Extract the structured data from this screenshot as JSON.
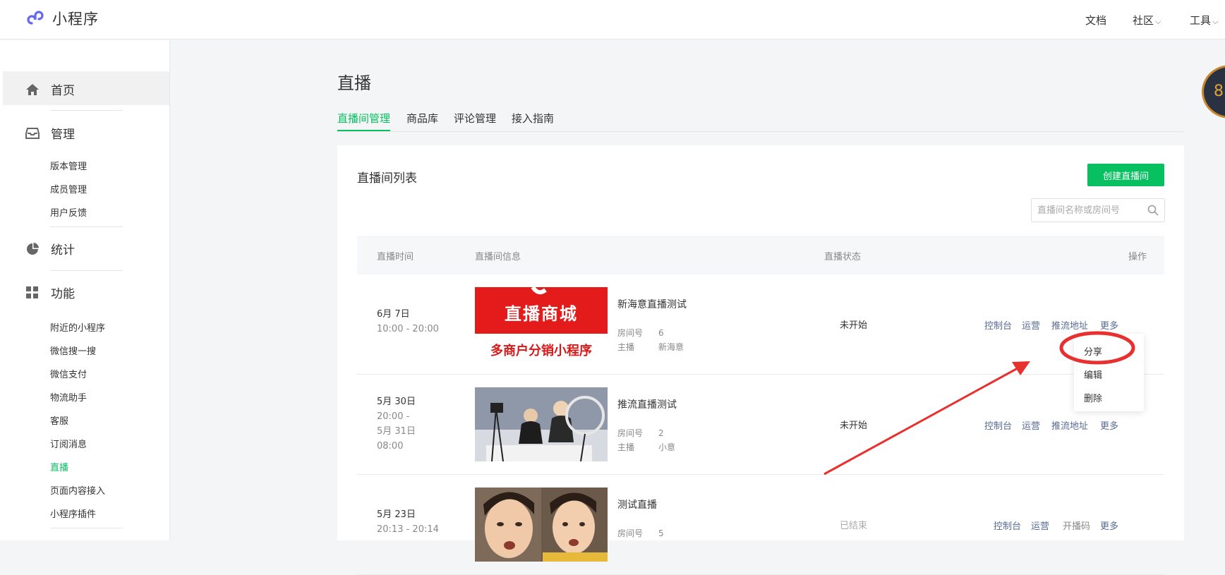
{
  "app": {
    "name": "小程序"
  },
  "topnav": {
    "docs": "文档",
    "community": "社区",
    "tools": "工具",
    "chevron": "⌵"
  },
  "sidebar": {
    "home": "首页",
    "manage": {
      "label": "管理",
      "items": [
        "版本管理",
        "成员管理",
        "用户反馈"
      ]
    },
    "stats": {
      "label": "统计"
    },
    "features": {
      "label": "功能",
      "items": [
        "附近的小程序",
        "微信搜一搜",
        "微信支付",
        "物流助手",
        "客服",
        "订阅消息",
        "直播",
        "页面内容接入",
        "小程序插件"
      ]
    }
  },
  "page": {
    "title": "直播",
    "tabs": [
      "直播间管理",
      "商品库",
      "评论管理",
      "接入指南"
    ],
    "list_title": "直播间列表",
    "create_button": "创建直播间",
    "search_placeholder": "直播间名称或房间号"
  },
  "table": {
    "headers": {
      "time": "直播时间",
      "info": "直播间信息",
      "status": "直播状态",
      "ops": "操作"
    },
    "labels": {
      "room": "房间号",
      "host": "主播"
    },
    "rows": [
      {
        "date": "6月 7日",
        "time": "10:00 - 20:00",
        "name": "新海意直播测试",
        "room": "6",
        "host": "新海意",
        "status": "未开始",
        "ops": [
          "控制台",
          "运营",
          "推流地址",
          "更多"
        ],
        "thumb_line1": "直播商城",
        "thumb_line2": "多商户分销小程序"
      },
      {
        "date": "5月 30日",
        "time": "20:00 -",
        "date2": "5月 31日",
        "time2": "08:00",
        "name": "推流直播测试",
        "room": "2",
        "host": "小意",
        "status": "未开始",
        "ops": [
          "控制台",
          "运营",
          "推流地址",
          "更多"
        ]
      },
      {
        "date": "5月 23日",
        "time": "20:13 - 20:14",
        "name": "测试直播",
        "room": "5",
        "status": "已结束",
        "ops": [
          "控制台",
          "运营",
          "开播码",
          "更多"
        ]
      }
    ]
  },
  "dropdown": {
    "items": [
      "分享",
      "编辑",
      "删除"
    ]
  },
  "badge": {
    "text": "8"
  },
  "colors": {
    "accent": "#07c160",
    "link": "#576b95",
    "annotation": "#e8312f"
  }
}
